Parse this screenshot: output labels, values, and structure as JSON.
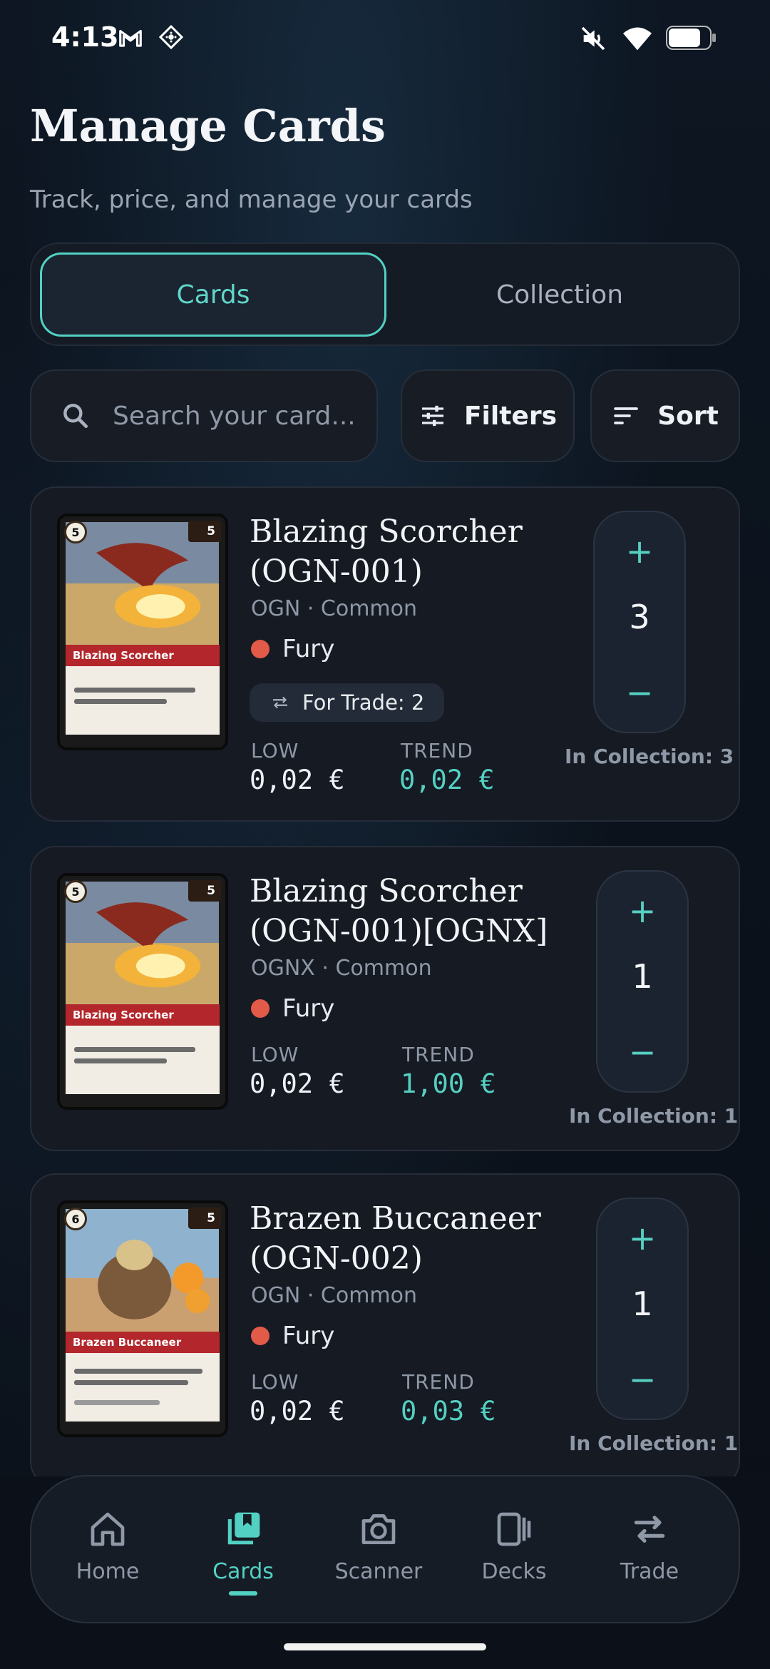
{
  "status_bar": {
    "time": "4:13"
  },
  "header": {
    "title": "Manage Cards",
    "subtitle": "Track, price, and manage your cards"
  },
  "tabs": [
    {
      "label": "Cards",
      "active": true
    },
    {
      "label": "Collection",
      "active": false
    }
  ],
  "search": {
    "placeholder": "Search your card..."
  },
  "toolbar": {
    "filters_label": "Filters",
    "sort_label": "Sort"
  },
  "price_labels": {
    "low": "LOW",
    "trend": "TREND"
  },
  "cards": [
    {
      "name": "Blazing Scorcher (OGN-001)",
      "art_title": "Blazing Scorcher",
      "cost": "5",
      "power": "5",
      "set_rarity": "OGN · Common",
      "domain": "Fury",
      "domain_color": "#e25a48",
      "for_trade": "For Trade: 2",
      "low": "0,02 €",
      "trend": "0,02 €",
      "quantity": "3",
      "in_collection": "In Collection: 3"
    },
    {
      "name": "Blazing Scorcher (OGN-001)[OGNX]",
      "art_title": "Blazing Scorcher",
      "cost": "5",
      "power": "5",
      "set_rarity": "OGNX · Common",
      "domain": "Fury",
      "domain_color": "#e25a48",
      "low": "0,02 €",
      "trend": "1,00 €",
      "quantity": "1",
      "in_collection": "In Collection: 1"
    },
    {
      "name": "Brazen Buccaneer (OGN-002)",
      "art_title": "Brazen Buccaneer",
      "cost": "6",
      "power": "5",
      "set_rarity": "OGN · Common",
      "domain": "Fury",
      "domain_color": "#e25a48",
      "low": "0,02 €",
      "trend": "0,03 €",
      "quantity": "1",
      "in_collection": "In Collection: 1"
    }
  ],
  "nav": [
    {
      "label": "Home",
      "icon": "home-icon",
      "active": false
    },
    {
      "label": "Cards",
      "icon": "cards-icon",
      "active": true
    },
    {
      "label": "Scanner",
      "icon": "camera-icon",
      "active": false
    },
    {
      "label": "Decks",
      "icon": "decks-icon",
      "active": false
    },
    {
      "label": "Trade",
      "icon": "swap-icon",
      "active": false
    }
  ],
  "colors": {
    "accent": "#52d1c3",
    "background": "#0c1119",
    "card": "#151a23"
  }
}
